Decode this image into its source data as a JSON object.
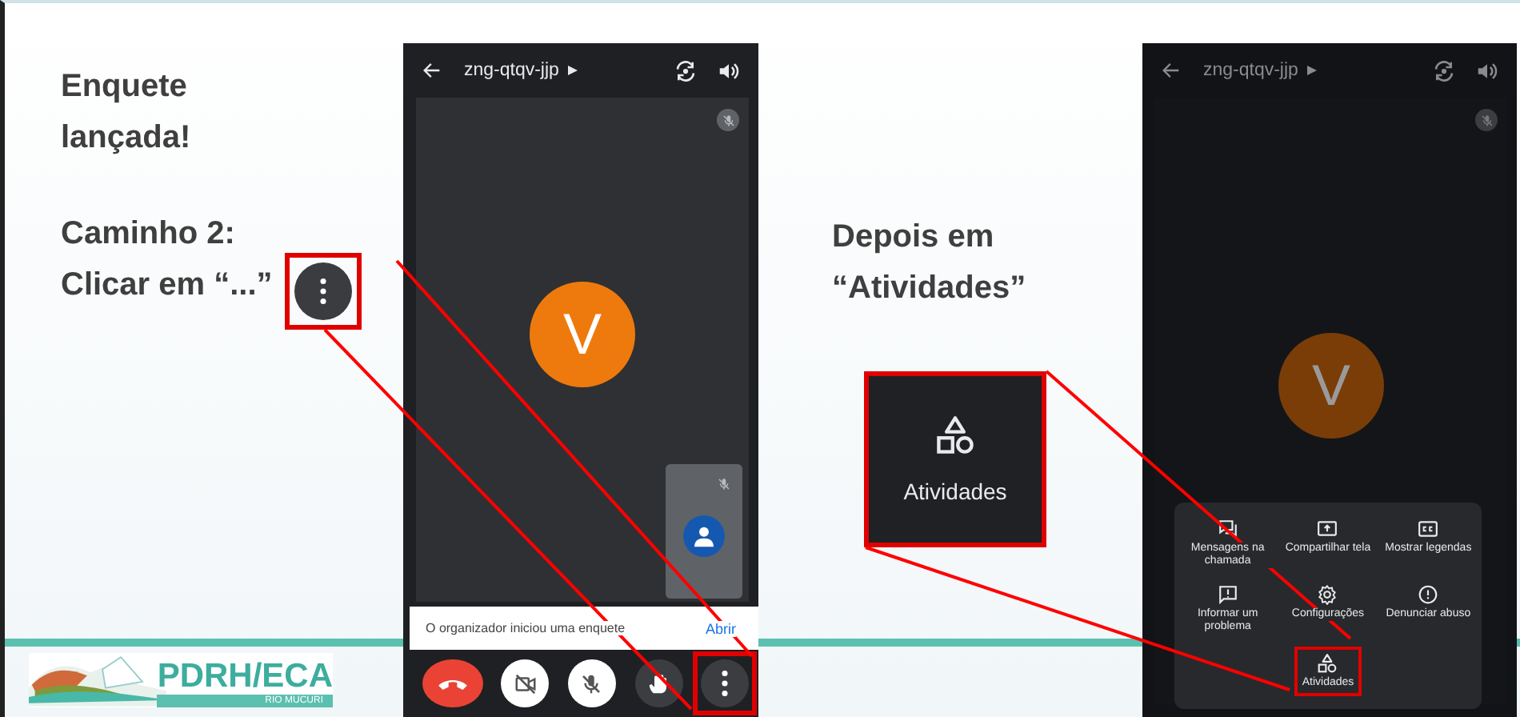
{
  "slide": {
    "heading": "Enquete lançada!",
    "step_left": "Caminho 2:\nClicar em “...”",
    "step_right": "Depois em\n“Atividades”",
    "callout_card": {
      "label": "Atividades"
    },
    "logo": {
      "title": "PDRH/ECA",
      "subtitle": "RIO MUCURI"
    }
  },
  "phone_left": {
    "meeting_code": "zng-qtqv-jjp",
    "avatar_letter": "V",
    "snackbar": {
      "text": "O organizador iniciou uma enquete",
      "action": "Abrir"
    },
    "controls": [
      {
        "kind": "end-call",
        "highlighted": false
      },
      {
        "kind": "camera-off",
        "highlighted": false
      },
      {
        "kind": "mic-off",
        "highlighted": false
      },
      {
        "kind": "raise-hand",
        "highlighted": false
      },
      {
        "kind": "more",
        "highlighted": true
      }
    ]
  },
  "phone_right": {
    "meeting_code": "zng-qtqv-jjp",
    "avatar_letter": "V",
    "menu": [
      {
        "kind": "chat",
        "label": "Mensagens na chamada",
        "highlighted": false
      },
      {
        "kind": "share",
        "label": "Compartilhar tela",
        "highlighted": false
      },
      {
        "kind": "captions",
        "label": "Mostrar legendas",
        "highlighted": false
      },
      {
        "kind": "report",
        "label": "Informar um problema",
        "highlighted": false
      },
      {
        "kind": "settings",
        "label": "Configurações",
        "highlighted": false
      },
      {
        "kind": "alert",
        "label": "Denunciar abuso",
        "highlighted": false
      },
      {
        "kind": "activities",
        "label": "Atividades",
        "highlighted": true
      }
    ]
  }
}
